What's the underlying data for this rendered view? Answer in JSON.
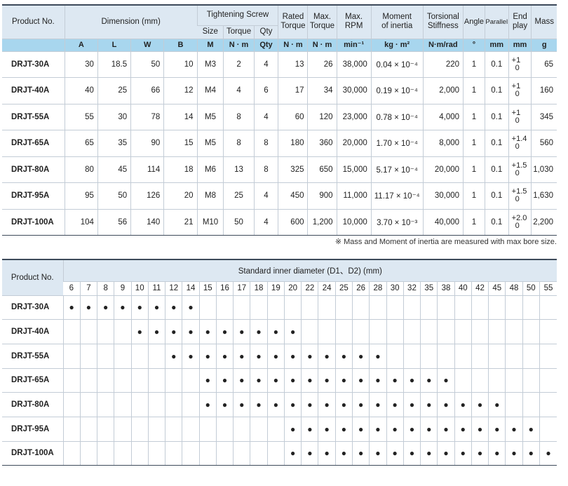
{
  "spec": {
    "headers": {
      "product": "Product No.",
      "dimension": "Dimension (mm)",
      "tightening": "Tightening Screw",
      "size": "Size",
      "torque": "Torque",
      "qty": "Qty",
      "rated_torque": [
        "Rated",
        "Torque"
      ],
      "max_torque": [
        "Max.",
        "Torque"
      ],
      "max_rpm": [
        "Max.",
        "RPM"
      ],
      "moment": [
        "Moment",
        "of inertia"
      ],
      "torsional": [
        "Torsional",
        "Stiffness"
      ],
      "angle": "Angle",
      "parallel": "Parallel",
      "end_play": [
        "End",
        "play"
      ],
      "mass": "Mass"
    },
    "units": [
      "A",
      "L",
      "W",
      "B",
      "M",
      "N · m",
      "Qty",
      "N · m",
      "N · m",
      "min⁻¹",
      "kg · m²",
      "N·m/rad",
      "°",
      "mm",
      "mm",
      "g"
    ],
    "rows": [
      {
        "product": "DRJT-30A",
        "A": "30",
        "L": "18.5",
        "W": "50",
        "B": "10",
        "M": "M3",
        "torque": "2",
        "qty": "4",
        "rated": "13",
        "max_torque": "26",
        "rpm": "38,000",
        "moment": "0.04 × 10⁻⁴",
        "stiffness": "220",
        "angle": "1",
        "parallel": "0.1",
        "end_hi": "+1",
        "end_lo": "0",
        "mass": "65"
      },
      {
        "product": "DRJT-40A",
        "A": "40",
        "L": "25",
        "W": "66",
        "B": "12",
        "M": "M4",
        "torque": "4",
        "qty": "6",
        "rated": "17",
        "max_torque": "34",
        "rpm": "30,000",
        "moment": "0.19 × 10⁻⁴",
        "stiffness": "2,000",
        "angle": "1",
        "parallel": "0.1",
        "end_hi": "+1",
        "end_lo": "0",
        "mass": "160"
      },
      {
        "product": "DRJT-55A",
        "A": "55",
        "L": "30",
        "W": "78",
        "B": "14",
        "M": "M5",
        "torque": "8",
        "qty": "4",
        "rated": "60",
        "max_torque": "120",
        "rpm": "23,000",
        "moment": "0.78 × 10⁻⁴",
        "stiffness": "4,000",
        "angle": "1",
        "parallel": "0.1",
        "end_hi": "+1",
        "end_lo": "0",
        "mass": "345"
      },
      {
        "product": "DRJT-65A",
        "A": "65",
        "L": "35",
        "W": "90",
        "B": "15",
        "M": "M5",
        "torque": "8",
        "qty": "8",
        "rated": "180",
        "max_torque": "360",
        "rpm": "20,000",
        "moment": "1.70 × 10⁻⁴",
        "stiffness": "8,000",
        "angle": "1",
        "parallel": "0.1",
        "end_hi": "+1.4",
        "end_lo": "0",
        "mass": "560"
      },
      {
        "product": "DRJT-80A",
        "A": "80",
        "L": "45",
        "W": "114",
        "B": "18",
        "M": "M6",
        "torque": "13",
        "qty": "8",
        "rated": "325",
        "max_torque": "650",
        "rpm": "15,000",
        "moment": "5.17 × 10⁻⁴",
        "stiffness": "20,000",
        "angle": "1",
        "parallel": "0.1",
        "end_hi": "+1.5",
        "end_lo": "0",
        "mass": "1,030"
      },
      {
        "product": "DRJT-95A",
        "A": "95",
        "L": "50",
        "W": "126",
        "B": "20",
        "M": "M8",
        "torque": "25",
        "qty": "4",
        "rated": "450",
        "max_torque": "900",
        "rpm": "11,000",
        "moment": "11.17 × 10⁻⁴",
        "stiffness": "30,000",
        "angle": "1",
        "parallel": "0.1",
        "end_hi": "+1.5",
        "end_lo": "0",
        "mass": "1,630"
      },
      {
        "product": "DRJT-100A",
        "A": "104",
        "L": "56",
        "W": "140",
        "B": "21",
        "M": "M10",
        "torque": "50",
        "qty": "4",
        "rated": "600",
        "max_torque": "1,200",
        "rpm": "10,000",
        "moment": "3.70 × 10⁻³",
        "stiffness": "40,000",
        "angle": "1",
        "parallel": "0.1",
        "end_hi": "+2.0",
        "end_lo": "0",
        "mass": "2,200"
      }
    ]
  },
  "note": "※ Mass and Moment of inertia are measured with max bore size.",
  "bore": {
    "product_header": "Product No.",
    "title": "Standard inner diameter  (D1、D2)   (mm)",
    "sizes": [
      "6",
      "7",
      "8",
      "9",
      "10",
      "11",
      "12",
      "14",
      "15",
      "16",
      "17",
      "18",
      "19",
      "20",
      "22",
      "24",
      "25",
      "26",
      "28",
      "30",
      "32",
      "35",
      "38",
      "40",
      "42",
      "45",
      "48",
      "50",
      "55"
    ],
    "dot_symbol": "●",
    "rows": [
      {
        "product": "DRJT-30A",
        "available": [
          "6",
          "7",
          "8",
          "9",
          "10",
          "11",
          "12",
          "14"
        ]
      },
      {
        "product": "DRJT-40A",
        "available": [
          "10",
          "11",
          "12",
          "14",
          "15",
          "16",
          "17",
          "18",
          "19",
          "20"
        ]
      },
      {
        "product": "DRJT-55A",
        "available": [
          "12",
          "14",
          "15",
          "16",
          "17",
          "18",
          "19",
          "20",
          "22",
          "24",
          "25",
          "26",
          "28"
        ]
      },
      {
        "product": "DRJT-65A",
        "available": [
          "15",
          "16",
          "17",
          "18",
          "19",
          "20",
          "22",
          "24",
          "25",
          "26",
          "28",
          "30",
          "32",
          "35",
          "38"
        ]
      },
      {
        "product": "DRJT-80A",
        "available": [
          "15",
          "16",
          "17",
          "18",
          "19",
          "20",
          "22",
          "24",
          "25",
          "26",
          "28",
          "30",
          "32",
          "35",
          "38",
          "40",
          "42",
          "45"
        ]
      },
      {
        "product": "DRJT-95A",
        "available": [
          "20",
          "22",
          "24",
          "25",
          "26",
          "28",
          "30",
          "32",
          "35",
          "38",
          "40",
          "42",
          "45",
          "48",
          "50"
        ]
      },
      {
        "product": "DRJT-100A",
        "available": [
          "20",
          "22",
          "24",
          "25",
          "26",
          "28",
          "30",
          "32",
          "35",
          "38",
          "40",
          "42",
          "45",
          "48",
          "50",
          "55"
        ]
      }
    ]
  }
}
